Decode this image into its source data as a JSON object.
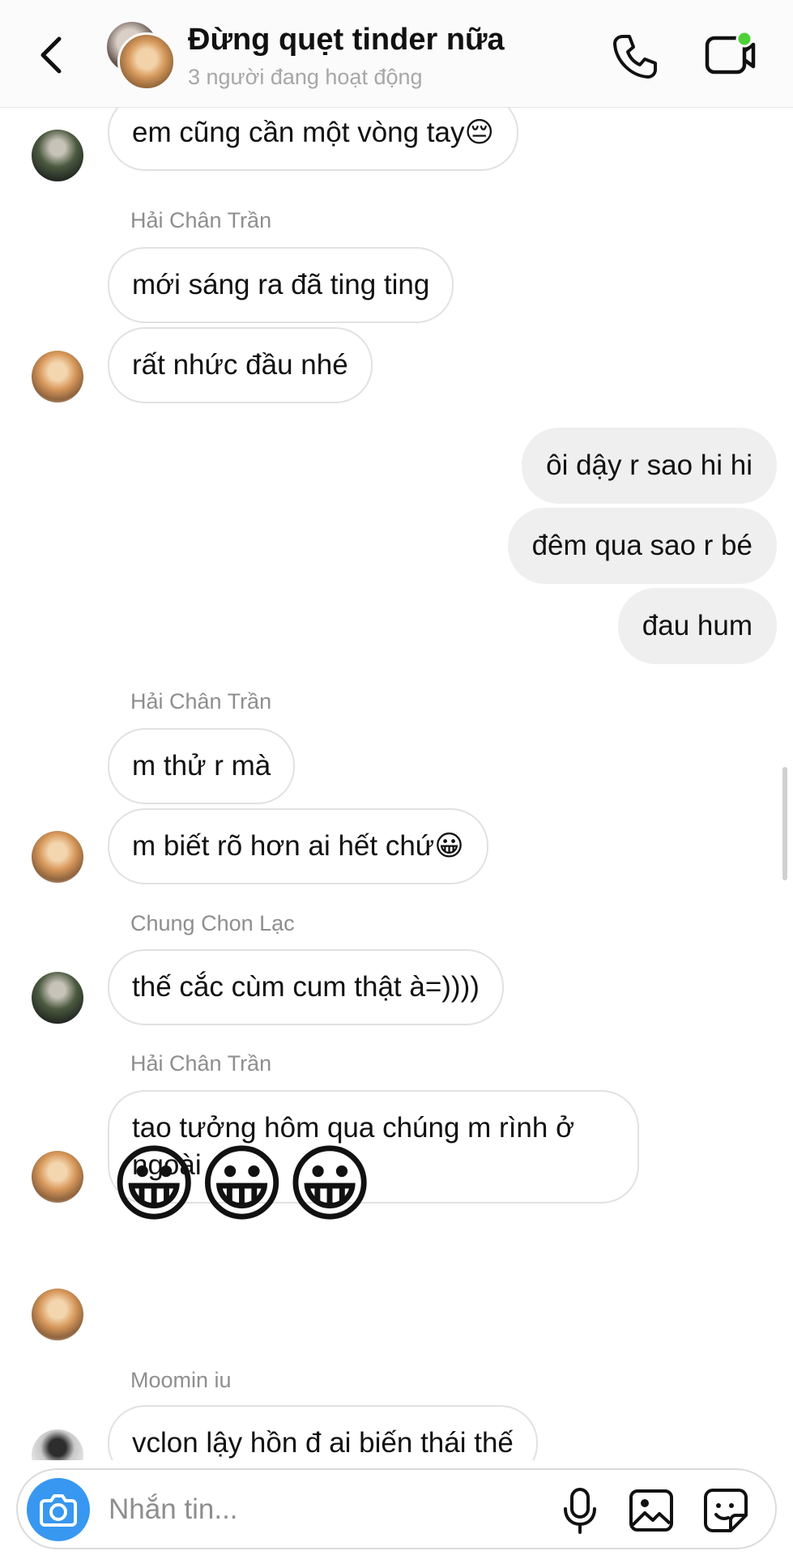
{
  "header": {
    "title": "Đừng quẹt tinder nữa",
    "subtitle": "3 người đang hoạt động",
    "back_icon": "chevron-left-icon",
    "call_icon": "phone-icon",
    "video_icon": "video-camera-icon",
    "online_dot_color": "#4cd137"
  },
  "messages": [
    {
      "type": "incoming",
      "text": "em cũng cần một vòng tay",
      "emoji": "😔"
    },
    {
      "type": "sender",
      "name": "Hải Chân Trần"
    },
    {
      "type": "incoming",
      "text": "mới sáng ra đã ting ting"
    },
    {
      "type": "incoming",
      "text": "rất nhức đầu nhé"
    },
    {
      "type": "outgoing",
      "text": "ôi dậy r sao hi hi"
    },
    {
      "type": "outgoing",
      "text": "đêm qua sao r bé"
    },
    {
      "type": "outgoing",
      "text": "đau hum"
    },
    {
      "type": "sender",
      "name": "Hải Chân Trần"
    },
    {
      "type": "incoming",
      "text": "m thử r mà"
    },
    {
      "type": "incoming",
      "text": "m biết rõ hơn ai hết chứ",
      "emoji": "😀"
    },
    {
      "type": "sender",
      "name": "Chung Chon Lạc"
    },
    {
      "type": "incoming",
      "text": "thế cắc cùm cum thật à=))))"
    },
    {
      "type": "sender",
      "name": "Hải Chân Trần"
    },
    {
      "type": "incoming",
      "text": "tao tưởng hôm qua chúng m rình ở ngoài"
    },
    {
      "type": "emoji",
      "text": "😀😀😀"
    },
    {
      "type": "sender",
      "name": "Moomin iu"
    },
    {
      "type": "incoming",
      "text": "vclon lậy hồn đ ai biến thái thế"
    }
  ],
  "composer": {
    "placeholder": "Nhắn tin...",
    "camera_icon": "camera-icon",
    "mic_icon": "microphone-icon",
    "gallery_icon": "image-icon",
    "sticker_icon": "sticker-icon",
    "accent_color": "#3897f0"
  }
}
